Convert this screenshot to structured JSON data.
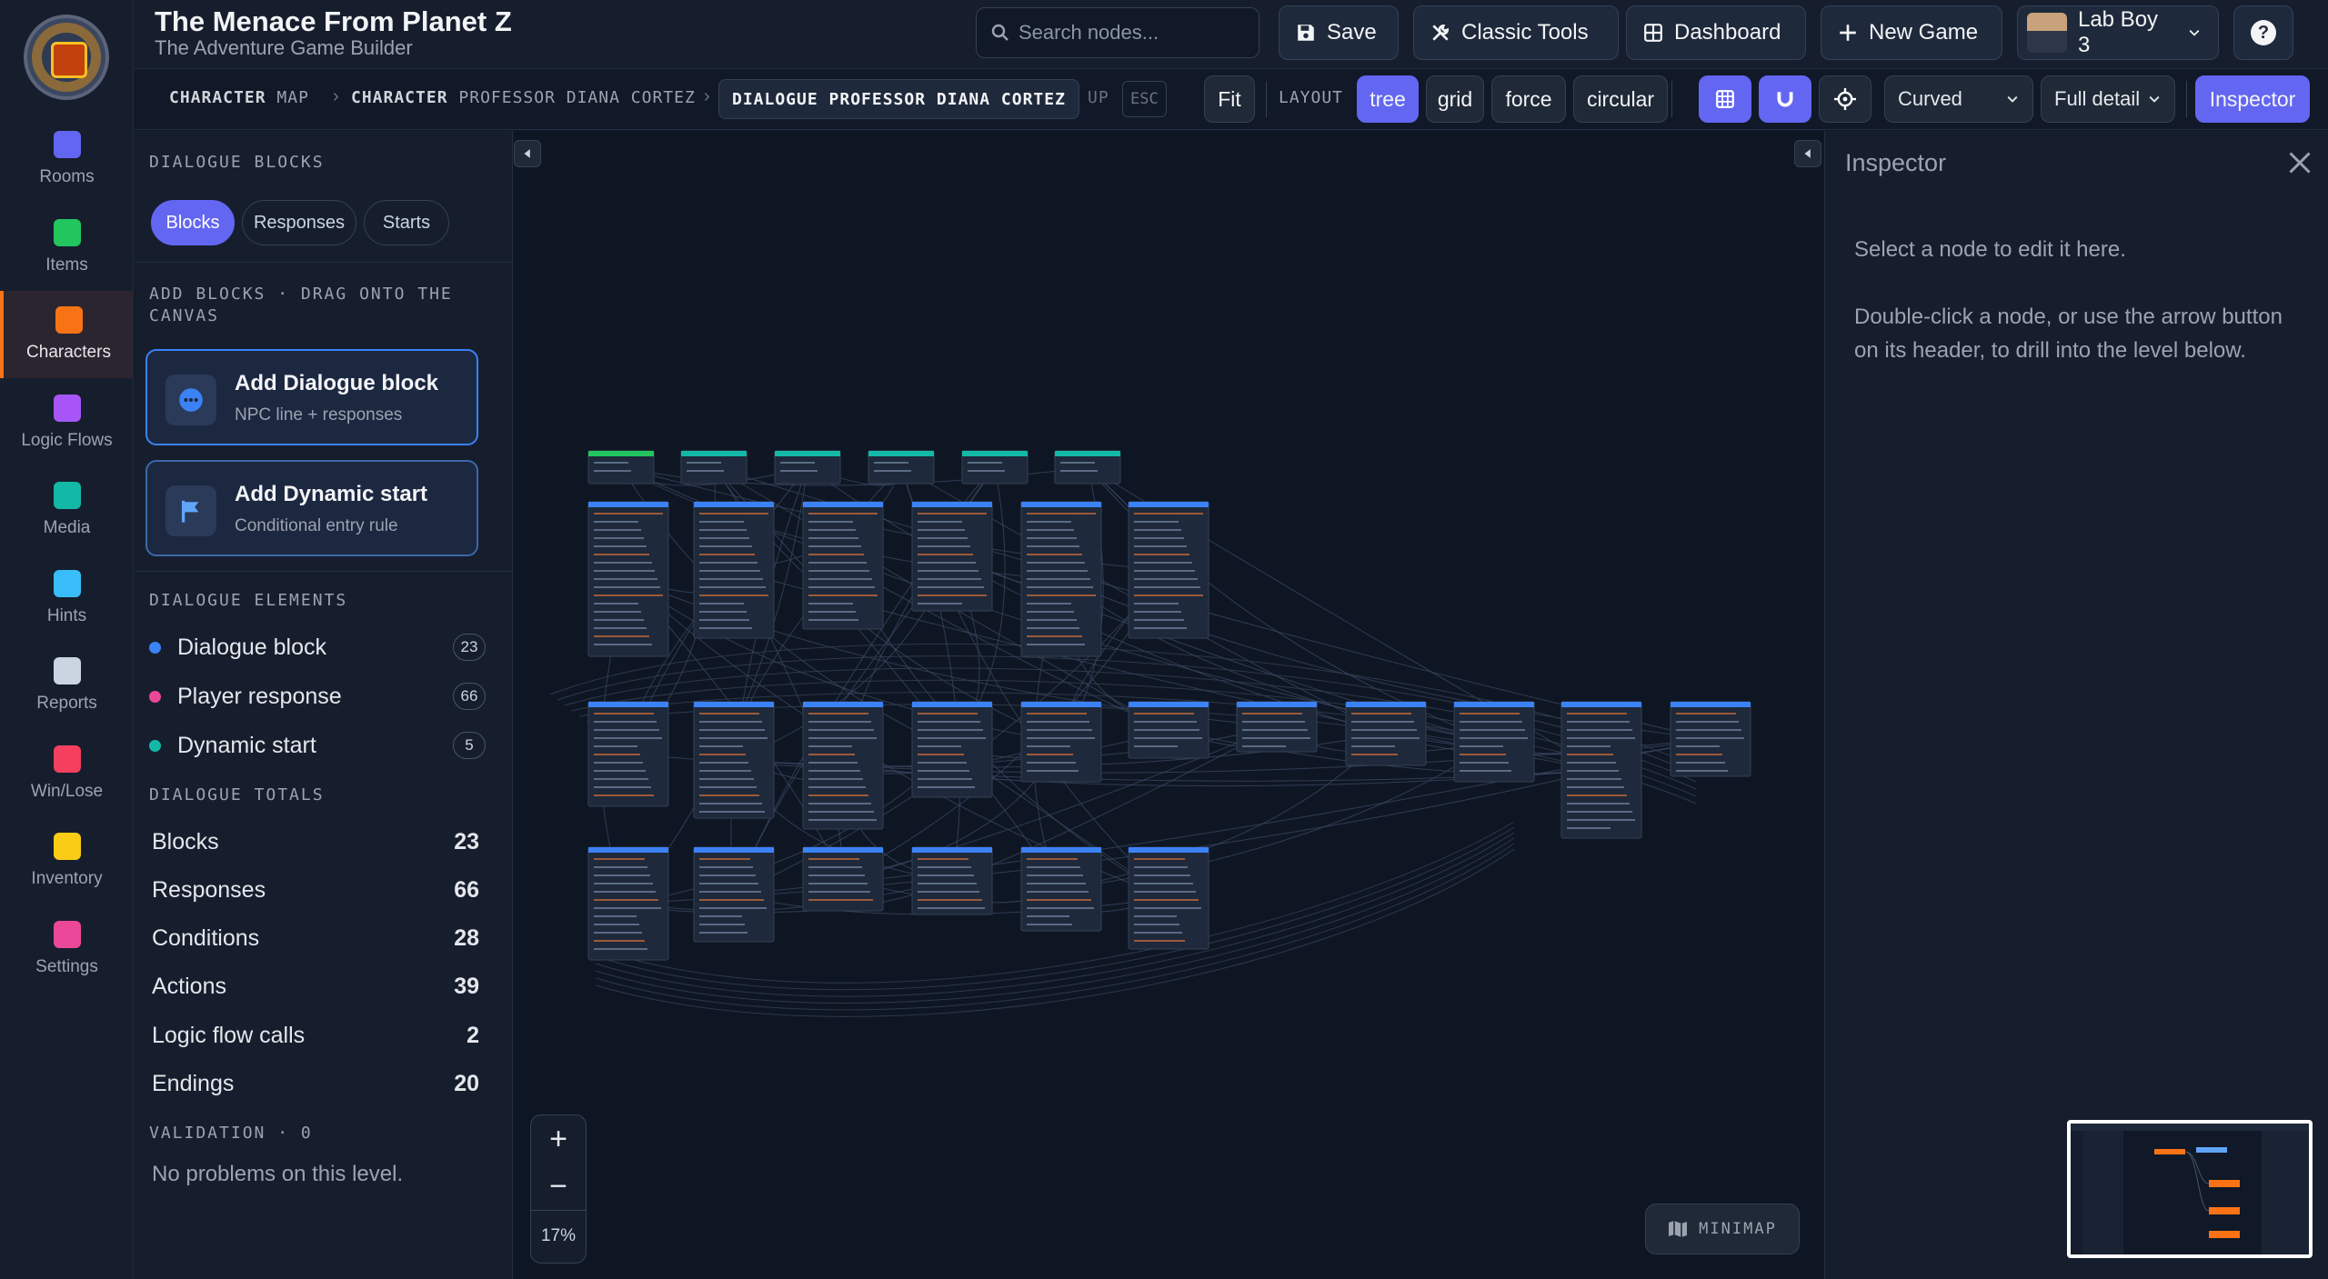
{
  "app": {
    "title": "The Menace From Planet Z",
    "subtitle": "The Adventure Game Builder"
  },
  "rail": {
    "items": [
      {
        "label": "Rooms",
        "icon": "door-icon",
        "color": "#6366f1"
      },
      {
        "label": "Items",
        "icon": "box-icon",
        "color": "#22c55e"
      },
      {
        "label": "Characters",
        "icon": "people-icon",
        "color": "#f97316",
        "active": true
      },
      {
        "label": "Logic Flows",
        "icon": "flow-icon",
        "color": "#a855f7"
      },
      {
        "label": "Media",
        "icon": "image-icon",
        "color": "#14b8a6"
      },
      {
        "label": "Hints",
        "icon": "bulb-icon",
        "color": "#38bdf8"
      },
      {
        "label": "Reports",
        "icon": "chart-icon",
        "color": "#cbd5e1"
      },
      {
        "label": "Win/Lose",
        "icon": "flag-icon",
        "color": "#f43f5e"
      },
      {
        "label": "Inventory",
        "icon": "swap-icon",
        "color": "#facc15"
      },
      {
        "label": "Settings",
        "icon": "sliders-icon",
        "color": "#ec4899"
      }
    ]
  },
  "header": {
    "search_placeholder": "Search nodes...",
    "save_label": "Save",
    "classic_label": "Classic Tools",
    "dashboard_label": "Dashboard",
    "new_game_label": "New Game",
    "user_label": "Lab Boy 3",
    "help_label": "?"
  },
  "toolbar": {
    "crumb1_kind": "CHARACTER",
    "crumb1_name": "MAP",
    "crumb2_kind": "CHARACTER",
    "crumb2_name": "PROFESSOR DIANA CORTEZ",
    "current": "DIALOGUE PROFESSOR DIANA CORTEZ",
    "up_label": "UP",
    "esc_label": "ESC",
    "fit_label": "Fit",
    "layout_label": "LAYOUT",
    "layouts": [
      "tree",
      "grid",
      "force",
      "circular"
    ],
    "active_layout": "tree",
    "edge_style": "Curved",
    "detail": "Full detail",
    "inspector_label": "Inspector"
  },
  "panel": {
    "section_blocks": "DIALOGUE BLOCKS",
    "tabs": [
      "Blocks",
      "Responses",
      "Starts"
    ],
    "add_title": "ADD BLOCKS · DRAG ONTO THE CANVAS",
    "add_dialogue_title": "Add Dialogue block",
    "add_dialogue_sub": "NPC line + responses",
    "add_start_title": "Add Dynamic start",
    "add_start_sub": "Conditional entry rule",
    "elements_title": "DIALOGUE ELEMENTS",
    "elements": [
      {
        "name": "Dialogue block",
        "count": "23",
        "color": "#3b82f6"
      },
      {
        "name": "Player response",
        "count": "66",
        "color": "#ec4899"
      },
      {
        "name": "Dynamic start",
        "count": "5",
        "color": "#14b8a6"
      }
    ],
    "totals_title": "DIALOGUE TOTALS",
    "totals": [
      {
        "label": "Blocks",
        "value": "23"
      },
      {
        "label": "Responses",
        "value": "66"
      },
      {
        "label": "Conditions",
        "value": "28"
      },
      {
        "label": "Actions",
        "value": "39"
      },
      {
        "label": "Logic flow calls",
        "value": "2"
      },
      {
        "label": "Endings",
        "value": "20"
      }
    ],
    "validation_title": "VALIDATION · 0",
    "validation_text": "No problems on this level."
  },
  "canvas": {
    "zoom_in": "+",
    "zoom_out": "−",
    "zoom_level": "17%",
    "minimap_label": "MINIMAP"
  },
  "inspector": {
    "title": "Inspector",
    "hint1": "Select a node to edit it here.",
    "hint2": "Double-click a node, or use the arrow button on its header, to drill into the level below."
  }
}
